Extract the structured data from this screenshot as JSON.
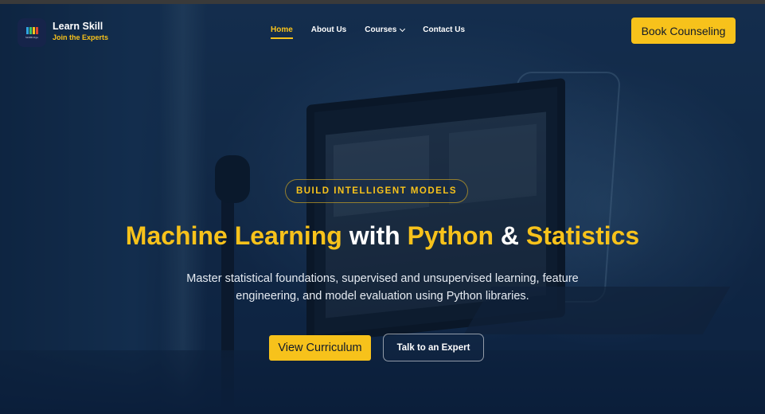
{
  "brand": {
    "name": "Learn Skill",
    "tagline": "Join the Experts",
    "logo_text": "SkillBridge",
    "logo_colors": [
      "#2fa6e0",
      "#3fc26a",
      "#f7c21b",
      "#e0452f"
    ]
  },
  "nav": {
    "items": [
      {
        "label": "Home",
        "active": true
      },
      {
        "label": "About Us",
        "active": false
      },
      {
        "label": "Courses",
        "active": false,
        "has_dropdown": true,
        "icon": "chevron-down-icon"
      },
      {
        "label": "Contact Us",
        "active": false
      }
    ]
  },
  "header": {
    "cta_label": "Book Counseling"
  },
  "hero": {
    "badge": "BUILD INTELLIGENT MODELS",
    "headline": {
      "part1": "Machine Learning",
      "part2": " with ",
      "part3": "Python",
      "part4": " & ",
      "part5": "Statistics"
    },
    "subtext": "Master statistical foundations, supervised and unsupervised learning, feature engineering, and model evaluation using Python libraries.",
    "primary_button": "View Curriculum",
    "secondary_button": "Talk to an Expert"
  },
  "colors": {
    "accent": "#f7c21b",
    "background": "#0d2240",
    "text": "#ffffff"
  }
}
